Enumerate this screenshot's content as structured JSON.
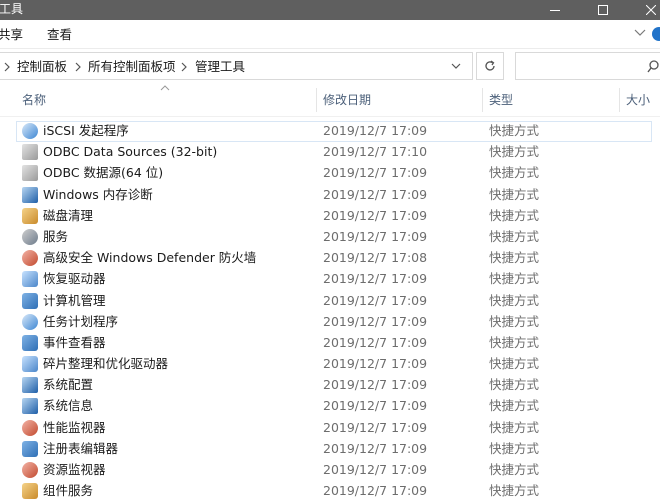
{
  "window": {
    "title": "工具"
  },
  "ribbon": {
    "tabs": [
      "共享",
      "查看"
    ]
  },
  "address": {
    "crumbs": [
      "控制面板",
      "所有控制面板项",
      "管理工具"
    ]
  },
  "search": {
    "placeholder": ""
  },
  "columns": {
    "name": "名称",
    "modified": "修改日期",
    "type": "类型",
    "size": "大小"
  },
  "files": [
    {
      "name": "iSCSI 发起程序",
      "modified": "2019/12/7 17:09",
      "type": "快捷方式",
      "icon": "iscsi-icon",
      "style": "ic-c"
    },
    {
      "name": "ODBC Data Sources (32-bit)",
      "modified": "2019/12/7 17:10",
      "type": "快捷方式",
      "icon": "odbc-icon",
      "style": "ic-b"
    },
    {
      "name": "ODBC 数据源(64 位)",
      "modified": "2019/12/7 17:09",
      "type": "快捷方式",
      "icon": "odbc-icon",
      "style": "ic-b"
    },
    {
      "name": "Windows 内存诊断",
      "modified": "2019/12/7 17:09",
      "type": "快捷方式",
      "icon": "memory-diagnostic-icon",
      "style": "ic-f"
    },
    {
      "name": "磁盘清理",
      "modified": "2019/12/7 17:09",
      "type": "快捷方式",
      "icon": "disk-cleanup-icon",
      "style": "ic-d"
    },
    {
      "name": "服务",
      "modified": "2019/12/7 17:09",
      "type": "快捷方式",
      "icon": "services-icon",
      "style": "ic-e"
    },
    {
      "name": "高级安全 Windows Defender 防火墙",
      "modified": "2019/12/7 17:08",
      "type": "快捷方式",
      "icon": "firewall-icon",
      "style": "ic-g"
    },
    {
      "name": "恢复驱动器",
      "modified": "2019/12/7 17:09",
      "type": "快捷方式",
      "icon": "recovery-drive-icon",
      "style": "ic-h"
    },
    {
      "name": "计算机管理",
      "modified": "2019/12/7 17:09",
      "type": "快捷方式",
      "icon": "computer-management-icon",
      "style": "ic-a"
    },
    {
      "name": "任务计划程序",
      "modified": "2019/12/7 17:09",
      "type": "快捷方式",
      "icon": "task-scheduler-icon",
      "style": "ic-c"
    },
    {
      "name": "事件查看器",
      "modified": "2019/12/7 17:09",
      "type": "快捷方式",
      "icon": "event-viewer-icon",
      "style": "ic-a"
    },
    {
      "name": "碎片整理和优化驱动器",
      "modified": "2019/12/7 17:09",
      "type": "快捷方式",
      "icon": "defrag-icon",
      "style": "ic-h"
    },
    {
      "name": "系统配置",
      "modified": "2019/12/7 17:09",
      "type": "快捷方式",
      "icon": "system-config-icon",
      "style": "ic-f"
    },
    {
      "name": "系统信息",
      "modified": "2019/12/7 17:09",
      "type": "快捷方式",
      "icon": "system-info-icon",
      "style": "ic-f"
    },
    {
      "name": "性能监视器",
      "modified": "2019/12/7 17:09",
      "type": "快捷方式",
      "icon": "performance-monitor-icon",
      "style": "ic-g"
    },
    {
      "name": "注册表编辑器",
      "modified": "2019/12/7 17:09",
      "type": "快捷方式",
      "icon": "registry-editor-icon",
      "style": "ic-a"
    },
    {
      "name": "资源监视器",
      "modified": "2019/12/7 17:09",
      "type": "快捷方式",
      "icon": "resource-monitor-icon",
      "style": "ic-g"
    },
    {
      "name": "组件服务",
      "modified": "2019/12/7 17:09",
      "type": "快捷方式",
      "icon": "component-services-icon",
      "style": "ic-d"
    }
  ]
}
